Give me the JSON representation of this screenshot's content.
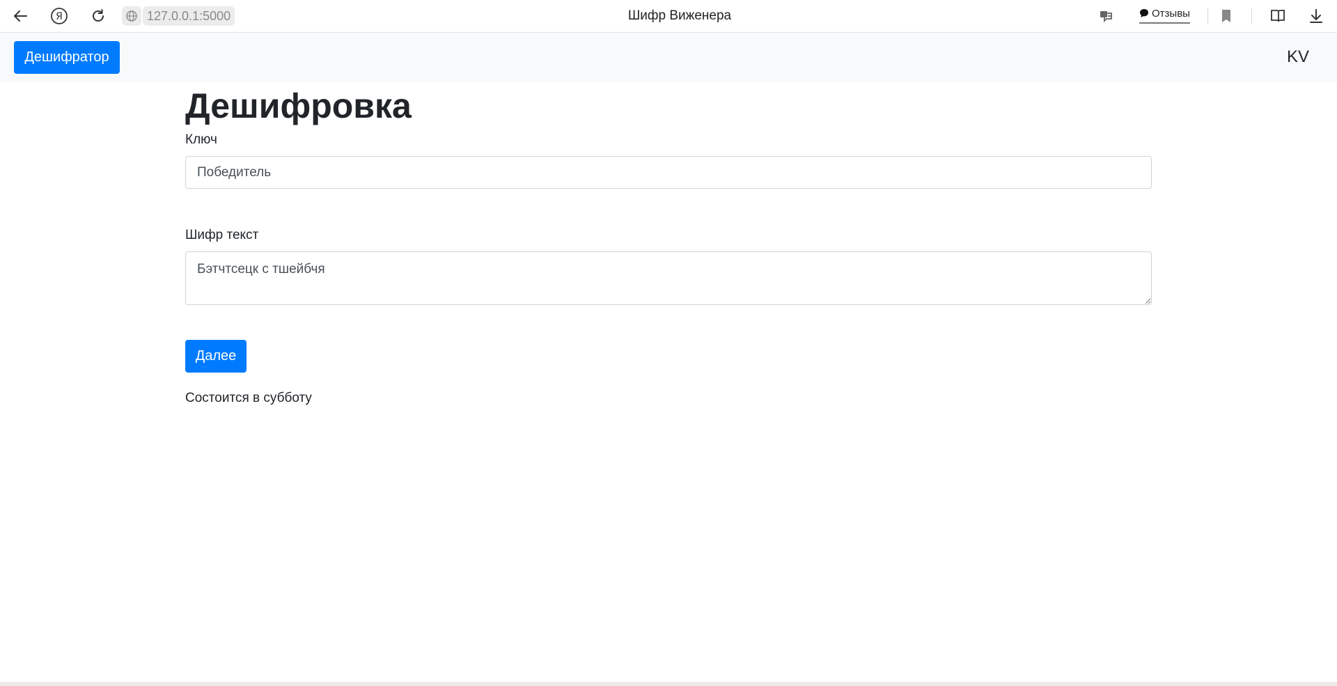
{
  "browser": {
    "url": "127.0.0.1:5000",
    "tab_title": "Шифр Виженера",
    "reviews_label": "Отзывы",
    "yandex_glyph": "Я",
    "icons": [
      "back-arrow-icon",
      "yandex-icon",
      "reload-icon",
      "globe-icon",
      "translate-icon",
      "chat-icon",
      "bookmark-icon",
      "reader-icon",
      "download-icon"
    ]
  },
  "navbar": {
    "brand_label": "Дешифратор",
    "right_label": "KV"
  },
  "main": {
    "title": "Дешифровка",
    "key_label": "Ключ",
    "key_value": "Победитель",
    "cipher_label": "Шифр текст",
    "cipher_value": "Бэтчтсецк с тшейбчя",
    "submit_label": "Далее",
    "result_text": "Состоится в субботу"
  },
  "colors": {
    "primary": "#007bff",
    "navbar_bg": "#f8f9fa",
    "text": "#212529"
  }
}
